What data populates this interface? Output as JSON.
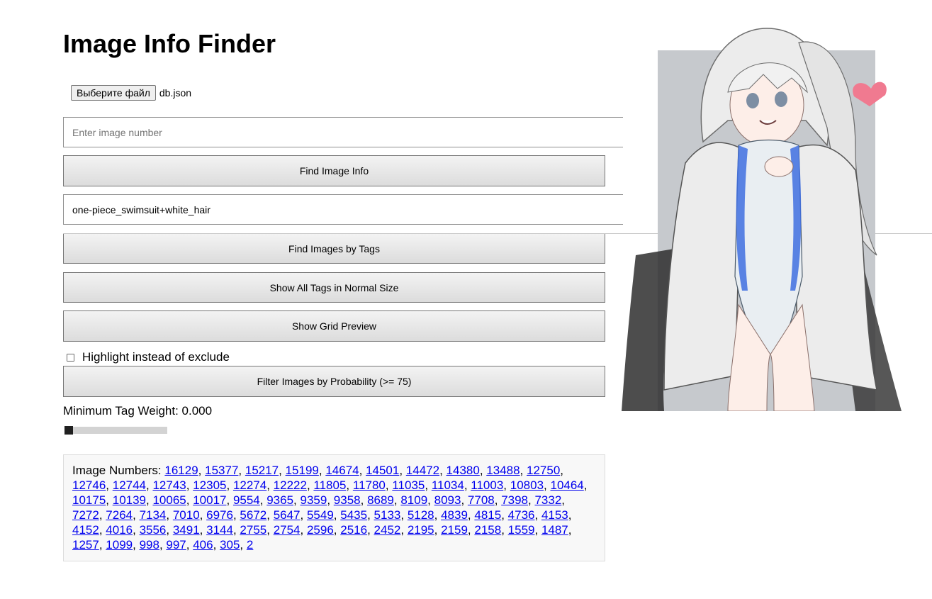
{
  "page": {
    "title": "Image Info Finder"
  },
  "file_picker": {
    "button_label": "Выберите файл",
    "file_name": "db.json"
  },
  "image_number_input": {
    "value": "",
    "placeholder": "Enter image number"
  },
  "find_info_button": {
    "label": "Find Image Info"
  },
  "tags_input": {
    "value": "one-piece_swimsuit+white_hair",
    "placeholder": ""
  },
  "find_tags_button": {
    "label": "Find Images by Tags"
  },
  "show_tags_button": {
    "label": "Show All Tags in Normal Size"
  },
  "grid_preview_button": {
    "label": "Show Grid Preview"
  },
  "highlight_checkbox": {
    "label": "Highlight instead of exclude",
    "checked": false
  },
  "filter_button": {
    "label": "Filter Images by Probability (>= 75)"
  },
  "min_weight": {
    "label": "Minimum Tag Weight: 0.000",
    "value": 0.0
  },
  "results": {
    "prefix": "Image Numbers: ",
    "numbers": [
      "16129",
      "15377",
      "15217",
      "15199",
      "14674",
      "14501",
      "14472",
      "14380",
      "13488",
      "12750",
      "12746",
      "12744",
      "12743",
      "12305",
      "12274",
      "12222",
      "11805",
      "11780",
      "11035",
      "11034",
      "11003",
      "10803",
      "10464",
      "10175",
      "10139",
      "10065",
      "10017",
      "9554",
      "9365",
      "9359",
      "9358",
      "8689",
      "8109",
      "8093",
      "7708",
      "7398",
      "7332",
      "7272",
      "7264",
      "7134",
      "7010",
      "6976",
      "5672",
      "5647",
      "5549",
      "5435",
      "5133",
      "5128",
      "4839",
      "4815",
      "4736",
      "4153",
      "4152",
      "4016",
      "3556",
      "3491",
      "3144",
      "2755",
      "2754",
      "2596",
      "2516",
      "2452",
      "2195",
      "2159",
      "2158",
      "1559",
      "1487",
      "1257",
      "1099",
      "998",
      "997",
      "406",
      "305",
      "2"
    ]
  },
  "colors": {
    "link": "#0000ee",
    "results_bg": "#f8f8f8",
    "picture_bg": "#c6c9cd",
    "heart": "#f07a90"
  }
}
